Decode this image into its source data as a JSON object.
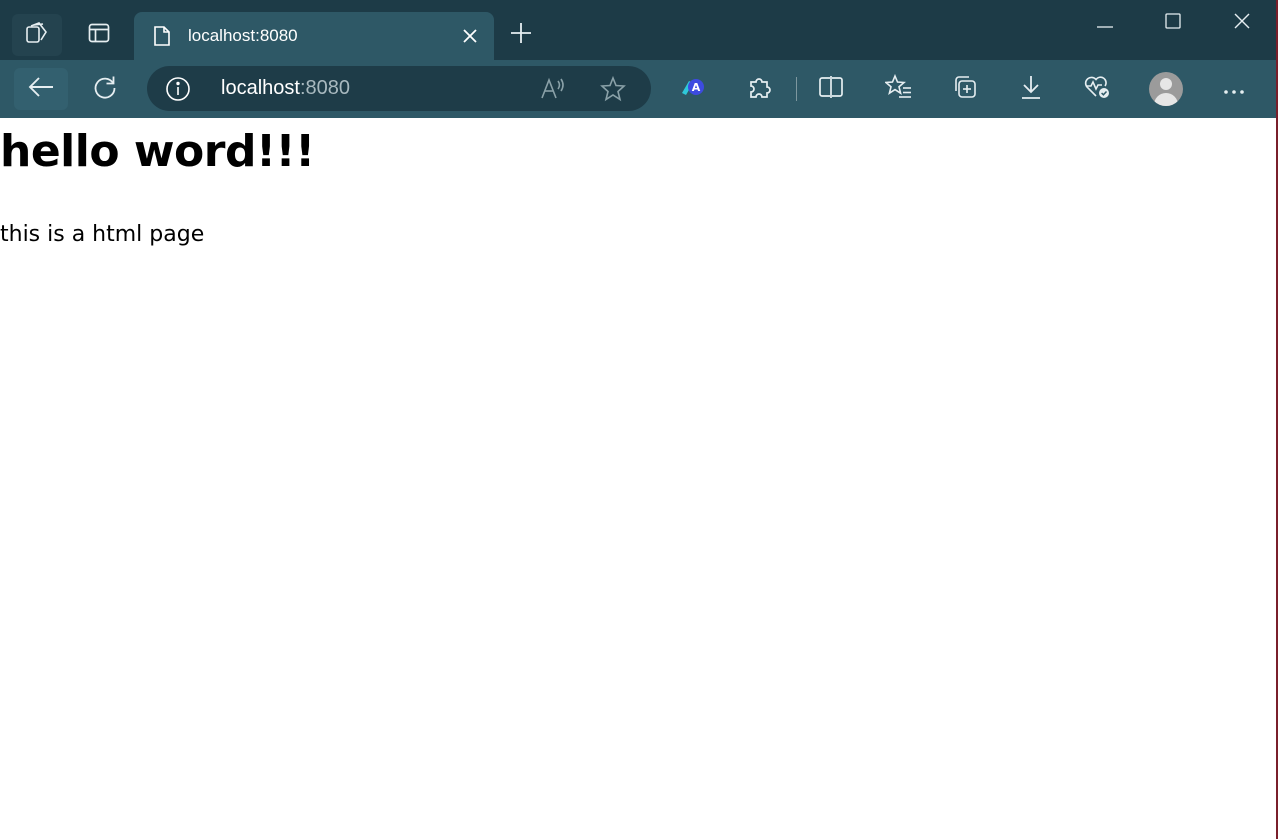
{
  "browser": {
    "tab": {
      "title": "localhost:8080"
    },
    "address_bar": {
      "host": "localhost",
      "port": ":8080"
    },
    "icons": {
      "tab_actions": "tab-actions-icon",
      "vertical_tabs": "vertical-tabs-icon",
      "favicon": "page-document-icon",
      "tab_close": "close-icon",
      "new_tab": "plus-icon",
      "minimize": "minimize-icon",
      "maximize": "maximize-icon",
      "window_close": "close-icon",
      "back": "back-arrow-icon",
      "refresh": "refresh-icon",
      "site_info": "info-icon",
      "read_aloud": "read-aloud-icon",
      "favorite": "star-icon",
      "extension_a": "extension-logo-icon",
      "extensions": "puzzle-icon",
      "split_screen": "split-screen-icon",
      "favorites": "favorites-list-icon",
      "collections": "collections-icon",
      "downloads": "download-icon",
      "browser_essentials": "heart-pulse-icon",
      "profile": "profile-avatar-icon",
      "more": "more-dots-icon"
    },
    "colors": {
      "tabstrip": "#1d3b47",
      "toolbar": "#2e5866",
      "address_bar": "#1e3c48"
    }
  },
  "page": {
    "heading": "hello word!!!",
    "paragraph": "this is a html page"
  }
}
